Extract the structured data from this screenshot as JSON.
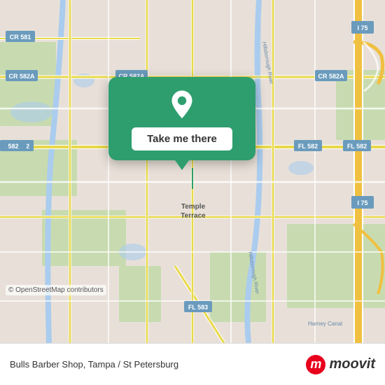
{
  "map": {
    "backgroundColor": "#e8e0d8",
    "attribution": "© OpenStreetMap contributors"
  },
  "popup": {
    "button_label": "Take me there",
    "icon": "location-pin"
  },
  "bottom_bar": {
    "location_text": "Bulls Barber Shop, Tampa / St Petersburg",
    "logo_text": "moovit"
  },
  "road_labels": {
    "cr581": "CR 581",
    "cr582a_left": "CR 582A",
    "cr582a_center": "CR 582A",
    "cr582a_right": "CR 582A",
    "fl582": "FL 582",
    "fl582_right": "FL 582",
    "fl583": "FL 583",
    "i75": "I 75",
    "fl582_label": "FL 582",
    "temple_terrace": "Temple Terrace",
    "harney_canal": "Harney Canal"
  }
}
